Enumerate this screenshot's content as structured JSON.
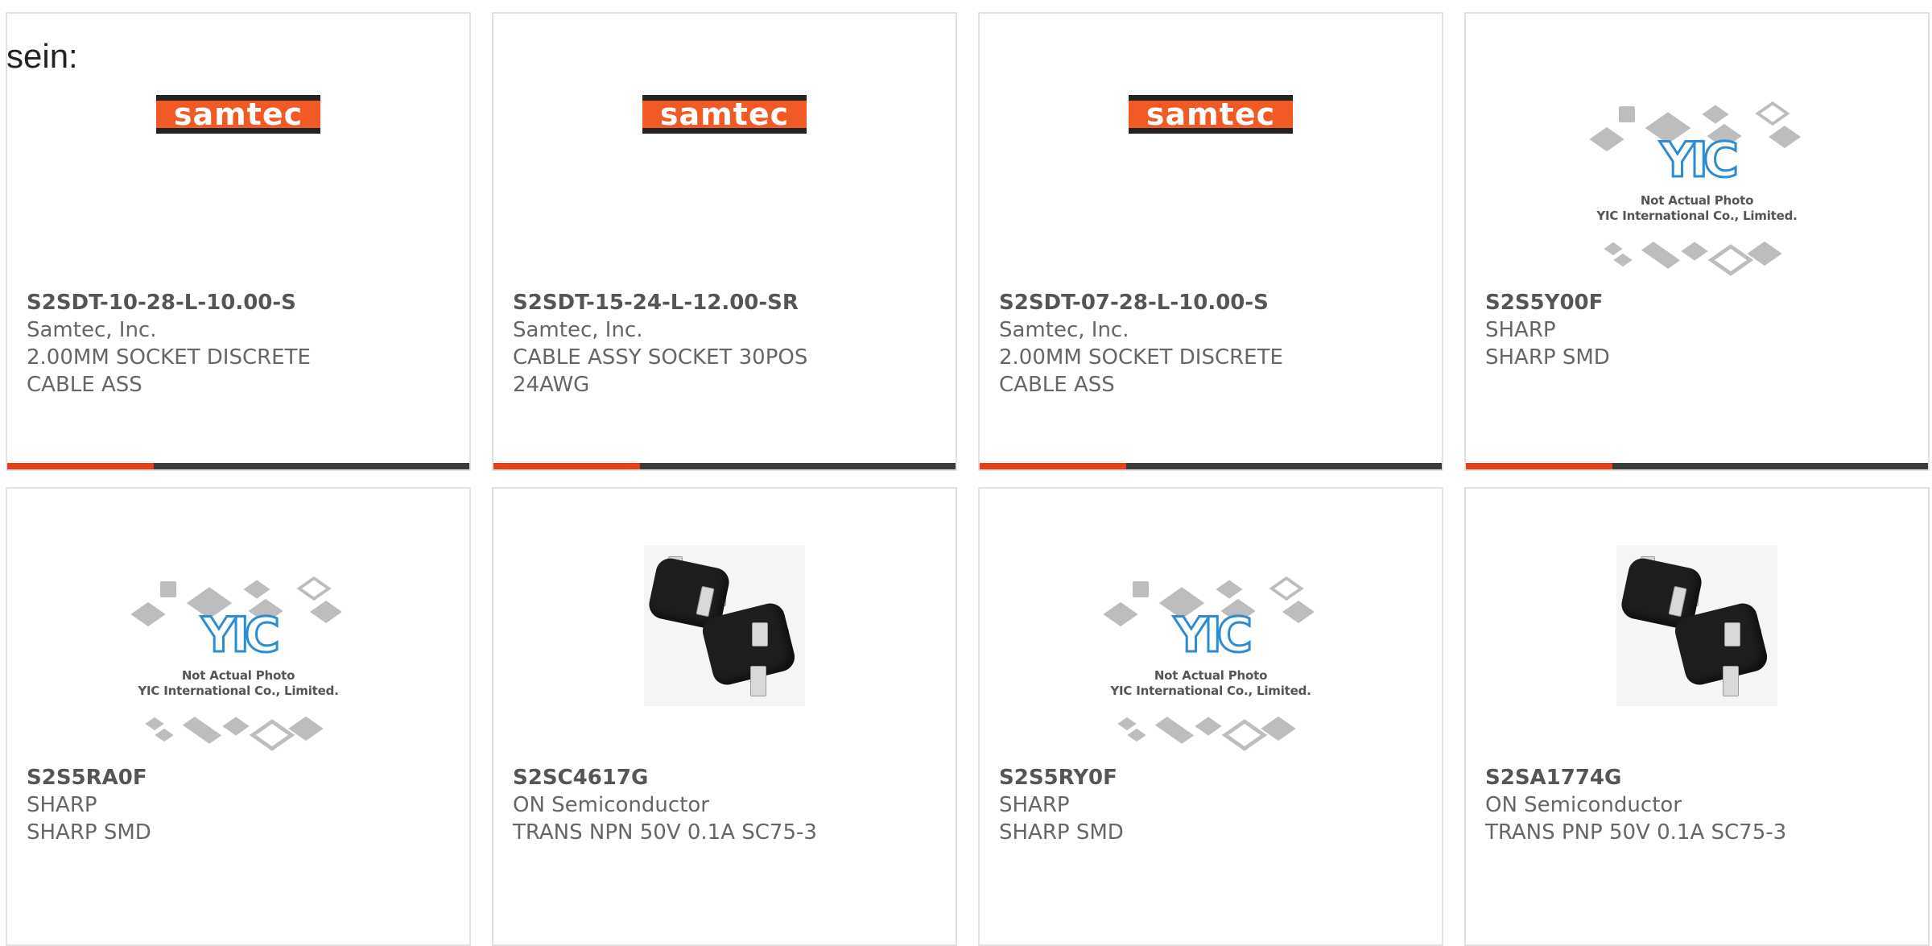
{
  "intro_text": "sein:",
  "colors": {
    "accent": "#e8401a",
    "bar": "#3b3b3b",
    "samtec_orange": "#f15a24",
    "yic_blue": "#2a8bd6"
  },
  "placeholder": {
    "logo_text": "YIC",
    "caption_line1": "Not Actual Photo",
    "caption_line2": "YIC International Co., Limited."
  },
  "samtec_logo_text": "samtec",
  "products": [
    {
      "part": "S2SDT-10-28-L-10.00-S",
      "manufacturer": "Samtec, Inc.",
      "desc1": "2.00MM SOCKET DISCRETE",
      "desc2": "CABLE ASS",
      "image": "samtec-logo"
    },
    {
      "part": "S2SDT-15-24-L-12.00-SR",
      "manufacturer": "Samtec, Inc.",
      "desc1": "CABLE ASSY SOCKET 30POS",
      "desc2": "24AWG",
      "image": "samtec-logo"
    },
    {
      "part": "S2SDT-07-28-L-10.00-S",
      "manufacturer": "Samtec, Inc.",
      "desc1": "2.00MM SOCKET DISCRETE",
      "desc2": "CABLE ASS",
      "image": "samtec-logo"
    },
    {
      "part": "S2S5Y00F",
      "manufacturer": "SHARP",
      "desc1": "SHARP SMD",
      "desc2": "",
      "image": "not-actual-photo"
    },
    {
      "part": "S2S5RA0F",
      "manufacturer": "SHARP",
      "desc1": "SHARP SMD",
      "desc2": "",
      "image": "not-actual-photo"
    },
    {
      "part": "S2SC4617G",
      "manufacturer": "ON Semiconductor",
      "desc1": "TRANS NPN 50V 0.1A SC75-3",
      "desc2": "",
      "image": "sc75-transistor"
    },
    {
      "part": "S2S5RY0F",
      "manufacturer": "SHARP",
      "desc1": "SHARP SMD",
      "desc2": "",
      "image": "not-actual-photo"
    },
    {
      "part": "S2SA1774G",
      "manufacturer": "ON Semiconductor",
      "desc1": "TRANS PNP 50V 0.1A SC75-3",
      "desc2": "",
      "image": "sc75-transistor"
    }
  ]
}
